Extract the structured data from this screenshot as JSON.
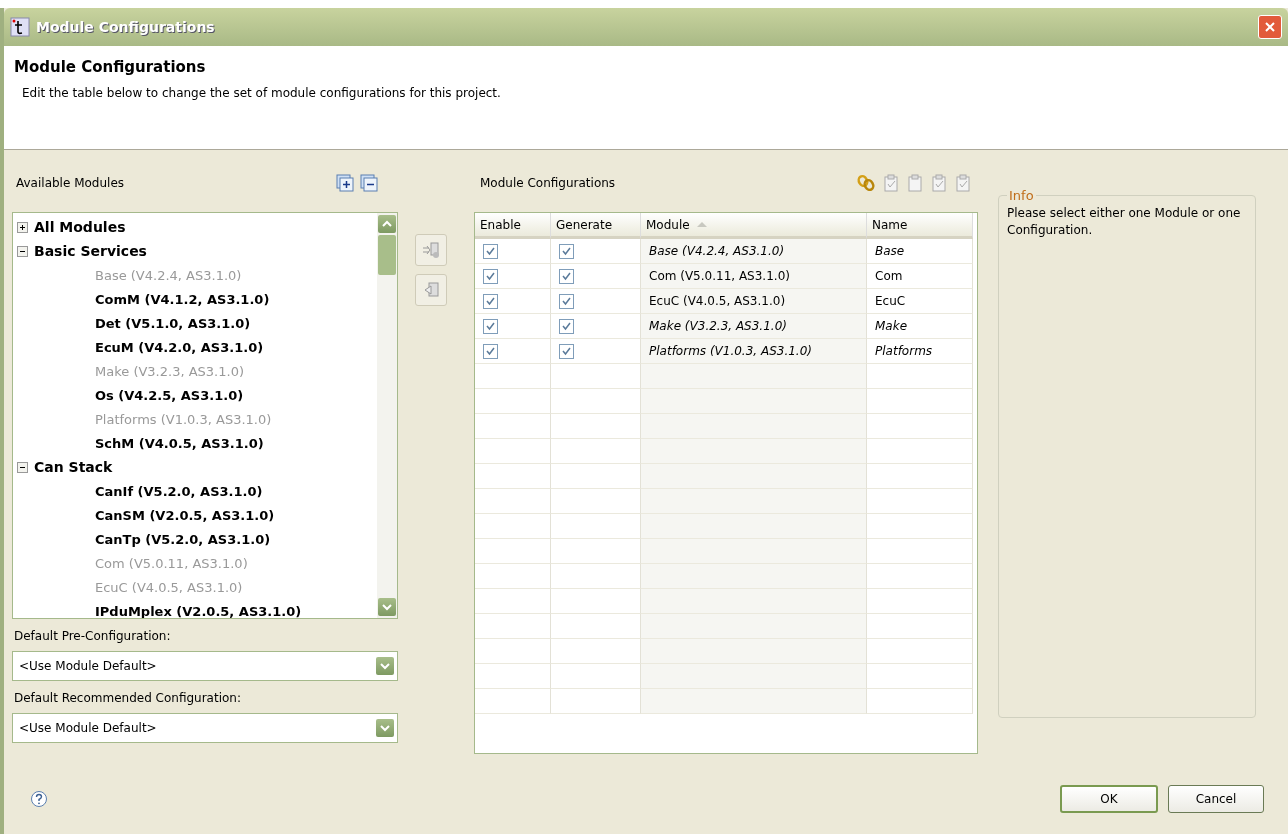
{
  "window": {
    "title": "Module Configurations"
  },
  "header": {
    "title": "Module Configurations",
    "description": "Edit the table below to change the set of module configurations for this project."
  },
  "available_modules": {
    "label": "Available Modules",
    "tree": [
      {
        "label": "All Modules",
        "enabled": true,
        "expanded": false
      },
      {
        "label": "Basic Services",
        "enabled": true,
        "expanded": true,
        "children": [
          {
            "label": "Base (V4.2.4, AS3.1.0)",
            "enabled": false
          },
          {
            "label": "ComM (V4.1.2, AS3.1.0)",
            "enabled": true
          },
          {
            "label": "Det (V5.1.0, AS3.1.0)",
            "enabled": true
          },
          {
            "label": "EcuM (V4.2.0, AS3.1.0)",
            "enabled": true
          },
          {
            "label": "Make (V3.2.3, AS3.1.0)",
            "enabled": false
          },
          {
            "label": "Os (V4.2.5, AS3.1.0)",
            "enabled": true
          },
          {
            "label": "Platforms (V1.0.3, AS3.1.0)",
            "enabled": false
          },
          {
            "label": "SchM (V4.0.5, AS3.1.0)",
            "enabled": true
          }
        ]
      },
      {
        "label": "Can Stack",
        "enabled": true,
        "expanded": true,
        "children": [
          {
            "label": "CanIf (V5.2.0, AS3.1.0)",
            "enabled": true
          },
          {
            "label": "CanSM (V2.0.5, AS3.1.0)",
            "enabled": true
          },
          {
            "label": "CanTp (V5.2.0, AS3.1.0)",
            "enabled": true
          },
          {
            "label": "Com (V5.0.11, AS3.1.0)",
            "enabled": false
          },
          {
            "label": "EcuC (V4.0.5, AS3.1.0)",
            "enabled": false
          },
          {
            "label": "IPduMplex (V2.0.5, AS3.1.0)",
            "enabled": true
          }
        ]
      }
    ],
    "pre_configuration": {
      "label": "Default Pre-Configuration:",
      "value": "<Use Module Default>"
    },
    "recommended_configuration": {
      "label": "Default Recommended Configuration:",
      "value": "<Use Module Default>"
    }
  },
  "module_configurations": {
    "label": "Module Configurations",
    "table": {
      "columns": [
        {
          "label": "Enable",
          "sorted": false
        },
        {
          "label": "Generate",
          "sorted": false
        },
        {
          "label": "Module",
          "sorted": true
        },
        {
          "label": "Name",
          "sorted": false
        }
      ],
      "rows": [
        {
          "enable": true,
          "generate": true,
          "module": "Base (V4.2.4, AS3.1.0)",
          "name": "Base",
          "italic": true
        },
        {
          "enable": true,
          "generate": true,
          "module": "Com (V5.0.11, AS3.1.0)",
          "name": "Com",
          "italic": false
        },
        {
          "enable": true,
          "generate": true,
          "module": "EcuC (V4.0.5, AS3.1.0)",
          "name": "EcuC",
          "italic": false
        },
        {
          "enable": true,
          "generate": true,
          "module": "Make (V3.2.3, AS3.1.0)",
          "name": "Make",
          "italic": true
        },
        {
          "enable": true,
          "generate": true,
          "module": "Platforms (V1.0.3, AS3.1.0)",
          "name": "Platforms",
          "italic": true
        }
      ]
    }
  },
  "info": {
    "title": "Info",
    "text": "Please select either one Module or one Configuration."
  },
  "buttons": [
    {
      "label": "OK",
      "default": true
    },
    {
      "label": "Cancel",
      "default": false
    }
  ]
}
